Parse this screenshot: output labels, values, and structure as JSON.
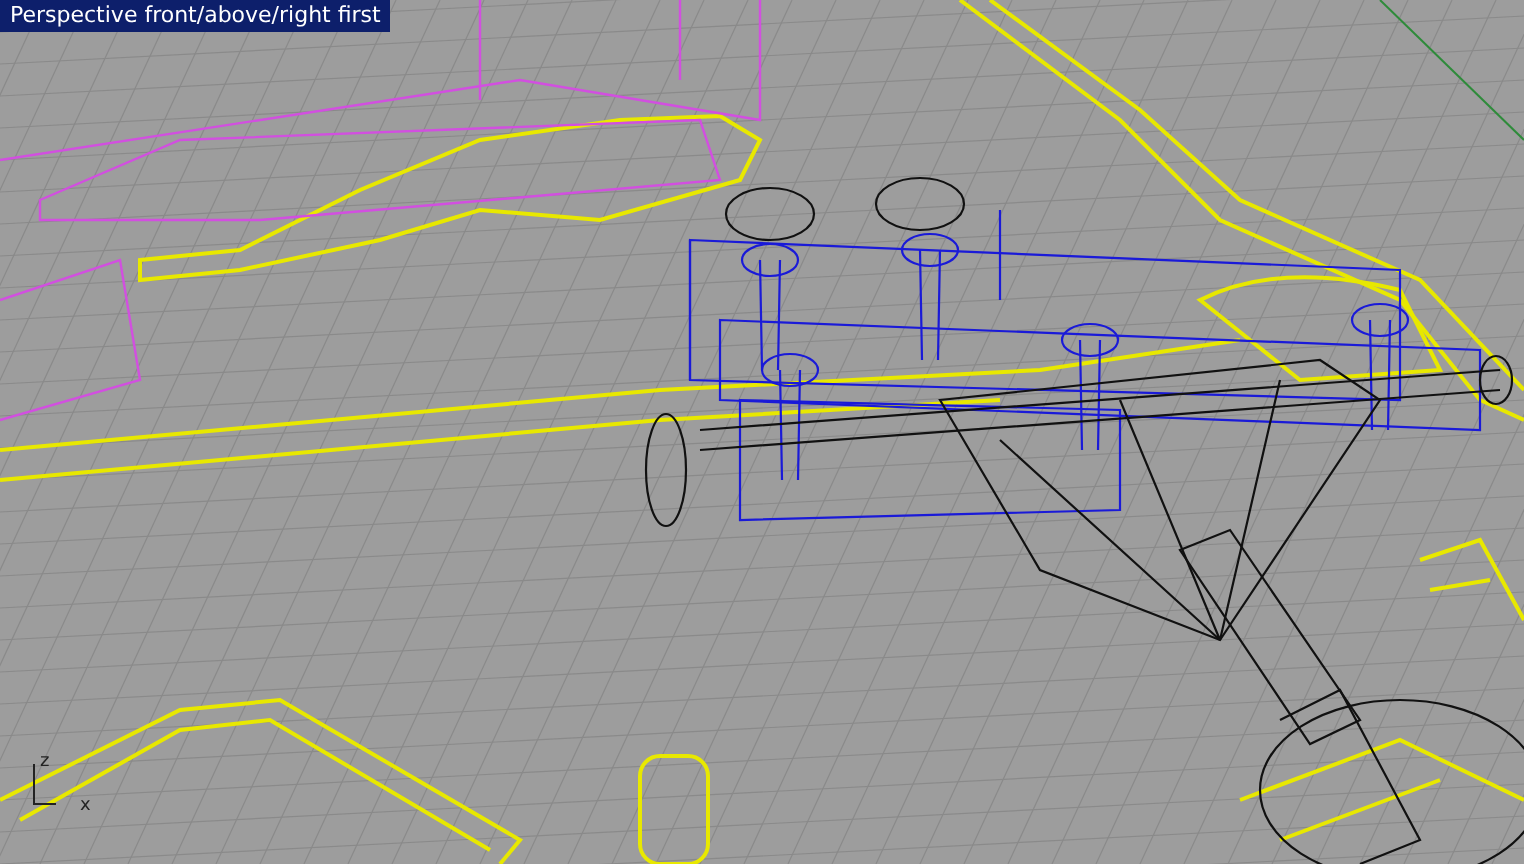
{
  "viewport": {
    "title": "Perspective front/above/right first",
    "axis_labels": [
      "z",
      "x"
    ]
  }
}
